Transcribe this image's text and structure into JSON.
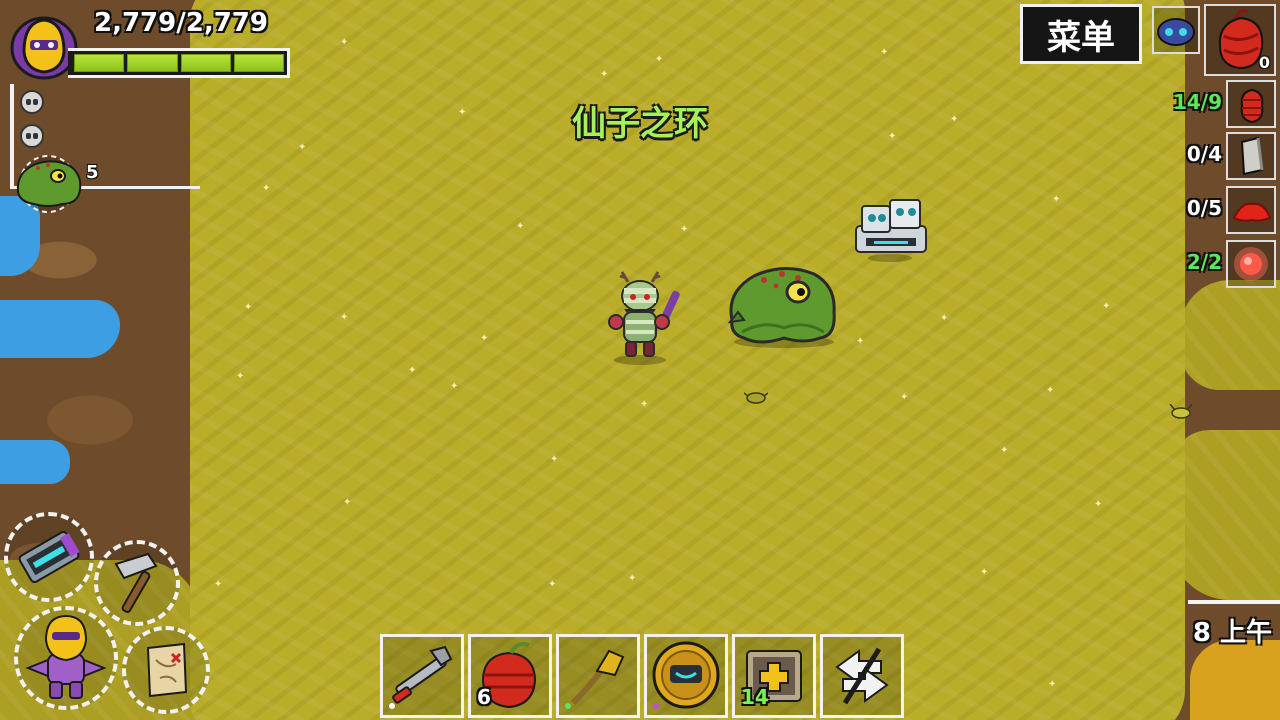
{
  "player": {
    "health_text": "2,779/2,779",
    "health_current": 2779,
    "health_max": 2779,
    "health_fraction": 1.0
  },
  "status_effects": [
    "skull-icon",
    "skull-icon"
  ],
  "pet": {
    "icon": "wompit-pet-icon",
    "count": "5"
  },
  "zone": {
    "title": "仙子之环"
  },
  "menu": {
    "label": "菜单"
  },
  "quest_slot": {
    "icon": "red-sac-icon",
    "count": "0"
  },
  "requirements": [
    {
      "text": "14/9",
      "color": "#5ee65a",
      "icon": "red-coil-icon"
    },
    {
      "text": "0/4",
      "color": "#ffffff",
      "icon": "stone-slab-icon"
    },
    {
      "text": "0/5",
      "color": "#ffffff",
      "icon": "red-powder-icon"
    },
    {
      "text": "2/2",
      "color": "#5ee65a",
      "icon": "glowing-orb-icon"
    }
  ],
  "clock": {
    "text": "8 上午"
  },
  "radial_buttons": [
    {
      "name": "build-mode-button",
      "icon": "device-icon"
    },
    {
      "name": "craft-hammer-button",
      "icon": "hammer-icon"
    },
    {
      "name": "character-button",
      "icon": "character-icon"
    },
    {
      "name": "quest-map-button",
      "icon": "scroll-map-icon"
    }
  ],
  "hotbar": [
    {
      "icon": "wrench-weapon-icon",
      "count": ""
    },
    {
      "icon": "red-bomb-icon",
      "count": "6"
    },
    {
      "icon": "crystal-staff-icon",
      "count": ""
    },
    {
      "icon": "golden-helmet-icon",
      "count": ""
    },
    {
      "icon": "healing-box-icon",
      "count": "14"
    },
    {
      "icon": "swap-arrows-icon",
      "count": ""
    }
  ],
  "colors": {
    "grass": "#b9ad2a",
    "dirt": "#6e4c2b",
    "water": "#3e9ee3",
    "health": "#a6d92c",
    "zone_title": "#a6f05a"
  }
}
